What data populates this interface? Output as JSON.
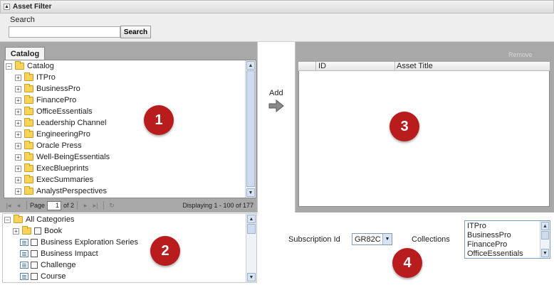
{
  "header": {
    "title": "Asset Filter"
  },
  "search": {
    "label": "Search",
    "button": "Search",
    "value": ""
  },
  "catalog": {
    "tab": "Catalog",
    "root": "Catalog",
    "items": [
      "ITPro",
      "BusinessPro",
      "FinancePro",
      "OfficeEssentials",
      "Leadership Channel",
      "EngineeringPro",
      "Oracle Press",
      "Well-BeingEssentials",
      "ExecBlueprints",
      "ExecSummaries",
      "AnalystPerspectives"
    ],
    "pager": {
      "page_label": "Page",
      "page_value": "1",
      "of_label": "of 2",
      "displaying": "Displaying 1 - 100 of 177"
    }
  },
  "categories": {
    "root": "All Categories",
    "book": "Book",
    "items": [
      "Business Exploration Series",
      "Business Impact",
      "Challenge",
      "Course"
    ]
  },
  "add": {
    "label": "Add"
  },
  "selected": {
    "remove": "Remove",
    "columns": [
      "ID",
      "Asset Title"
    ]
  },
  "subscription": {
    "label": "Subscription Id",
    "value": "GR82C",
    "collections_label": "Collections",
    "collections": [
      "ITPro",
      "BusinessPro",
      "FinancePro",
      "OfficeEssentials"
    ]
  },
  "badges": [
    "1",
    "2",
    "3",
    "4"
  ]
}
